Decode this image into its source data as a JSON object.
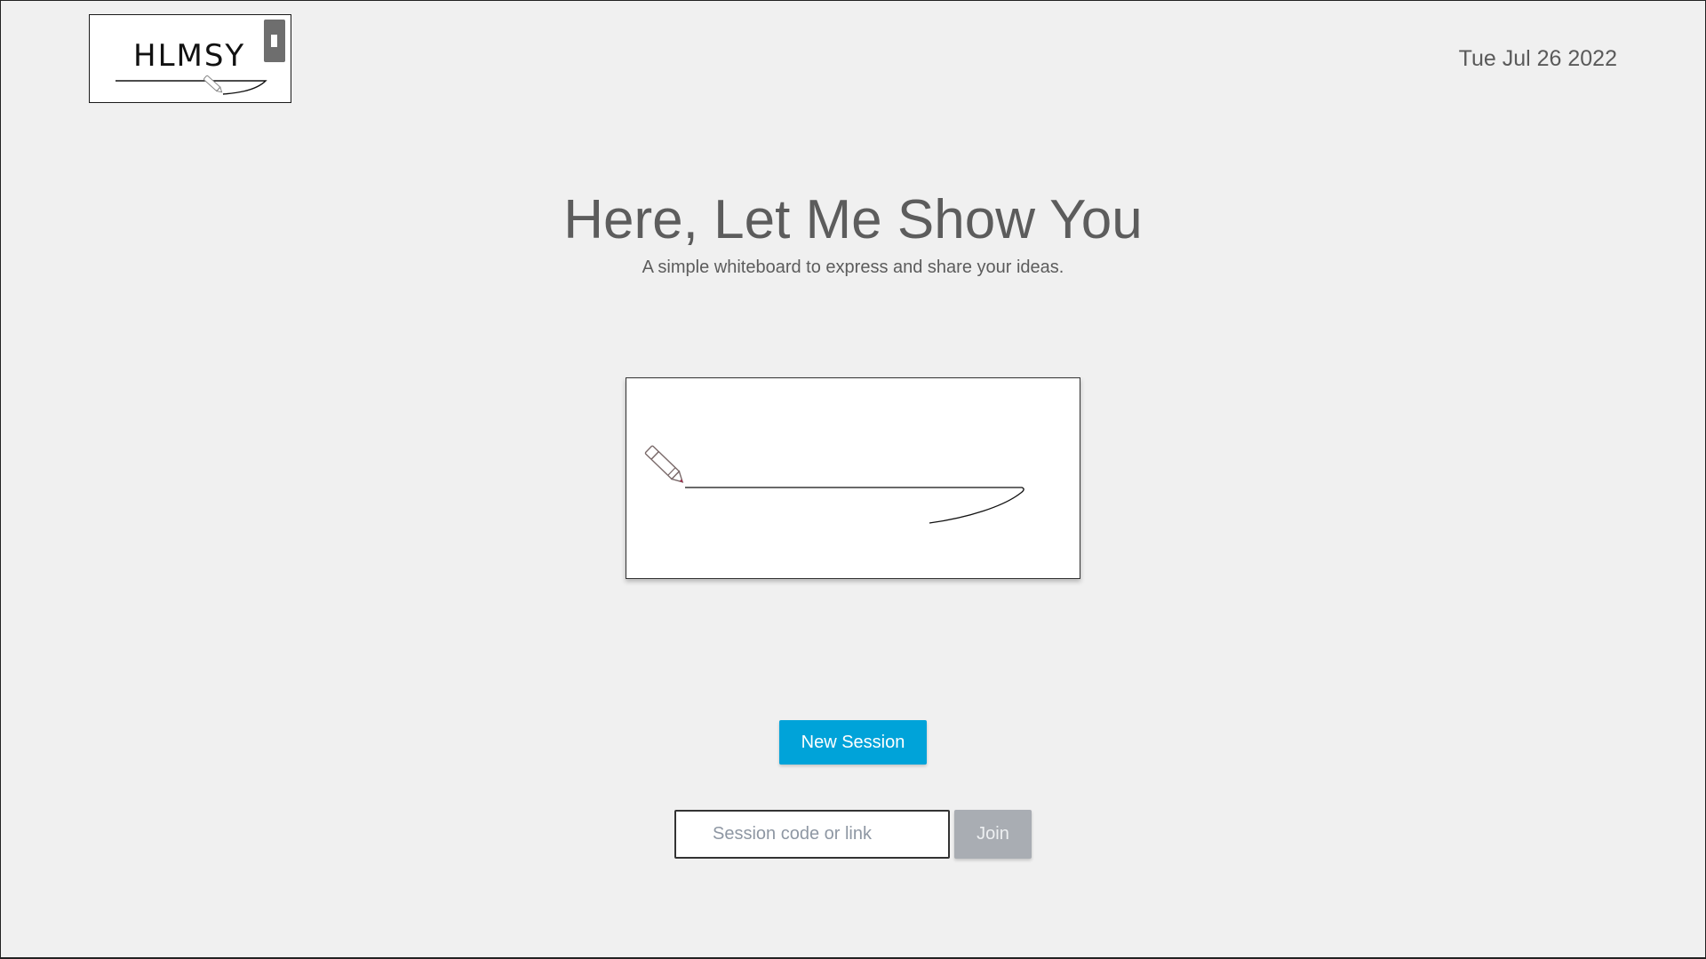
{
  "logo": {
    "text": "HLMSY"
  },
  "header": {
    "date": "Tue Jul 26 2022"
  },
  "hero": {
    "title": "Here, Let Me Show You",
    "subtitle": "A simple whiteboard to express and share your ideas."
  },
  "preview": {
    "icon": "pen-icon"
  },
  "actions": {
    "new_session_label": "New Session",
    "join_label": "Join",
    "session_placeholder": "Session code or link",
    "session_value": ""
  },
  "colors": {
    "background": "#f0f0f0",
    "primary_button": "#00a3d9",
    "disabled_button": "#a9adb3",
    "text": "#5c5c5c"
  }
}
